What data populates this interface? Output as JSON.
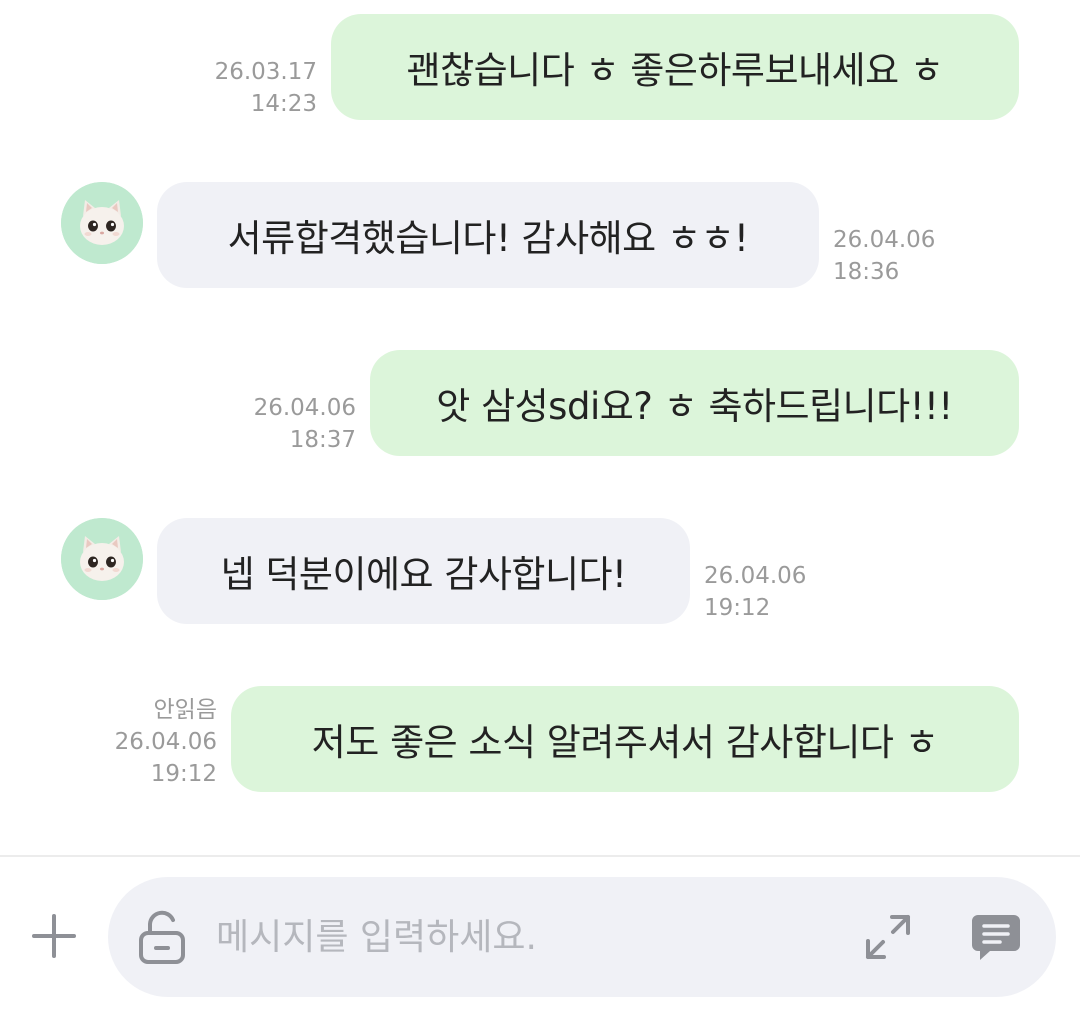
{
  "messages": [
    {
      "side": "mine",
      "text": "괜찮습니다 ㅎ 좋은하루보내세요 ㅎ",
      "date": "26.03.17",
      "time": "14:23",
      "unread": ""
    },
    {
      "side": "theirs",
      "text": "서류합격했습니다! 감사해요 ㅎㅎ!",
      "date": "26.04.06",
      "time": "18:36"
    },
    {
      "side": "mine",
      "text": "앗 삼성sdi요? ㅎ 축하드립니다!!!",
      "date": "26.04.06",
      "time": "18:37",
      "unread": ""
    },
    {
      "side": "theirs",
      "text": "넵 덕분이에요 감사합니다!",
      "date": "26.04.06",
      "time": "19:12"
    },
    {
      "side": "mine",
      "text": "저도 좋은 소식 알려주셔서 감사합니다 ㅎ",
      "date": "26.04.06",
      "time": "19:12",
      "unread": "안읽음"
    }
  ],
  "composer": {
    "placeholder": "메시지를 입력하세요.",
    "value": ""
  },
  "icons": {
    "plus": "plus-icon",
    "lock": "unlock-icon",
    "expand": "expand-icon",
    "send": "message-bubble-icon"
  },
  "colors": {
    "mine_bubble": "#dcf5da",
    "theirs_bubble": "#f0f1f6",
    "meta_text": "#9a9a9a",
    "icon_gray": "#8e9096",
    "avatar_bg": "#bfe9cf"
  }
}
